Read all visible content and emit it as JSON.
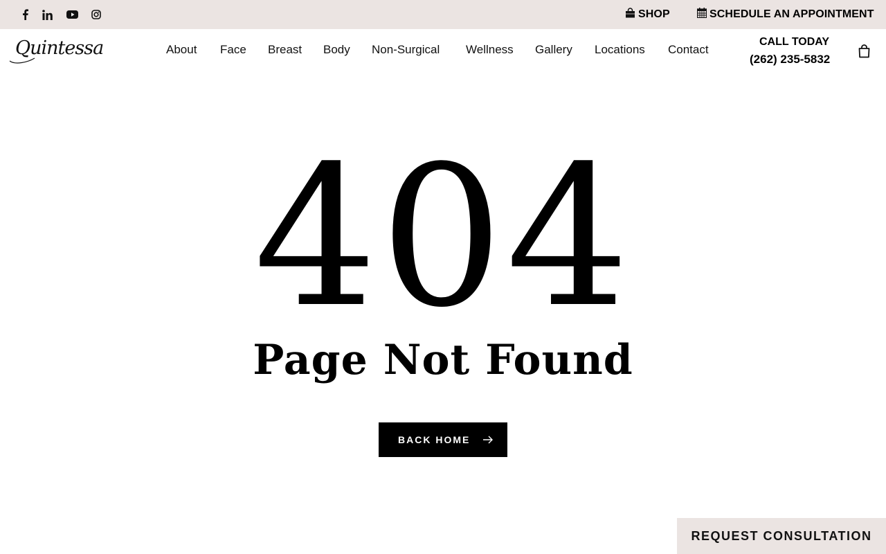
{
  "topbar": {
    "social": [
      {
        "icon": "facebook-icon"
      },
      {
        "icon": "linkedin-icon"
      },
      {
        "icon": "youtube-icon"
      },
      {
        "icon": "instagram-icon"
      }
    ],
    "shop_label": "SHOP",
    "schedule_label": "SCHEDULE AN APPOINTMENT",
    "background": "#ebe4e2"
  },
  "header": {
    "logo_text": "Quintessa",
    "nav": [
      "About",
      "Face",
      "Breast",
      "Body",
      "Non-Surgical",
      "Wellness",
      "Gallery",
      "Locations",
      "Contact"
    ],
    "call_label": "CALL TODAY",
    "phone": "(262) 235-5832",
    "cart_icon": "shopping-bag-icon"
  },
  "main": {
    "error_code": "404",
    "title": "Page Not Found",
    "back_button": "BACK HOME",
    "back_icon": "arrow-right-icon"
  },
  "floating": {
    "consult_label": "REQUEST CONSULTATION"
  }
}
